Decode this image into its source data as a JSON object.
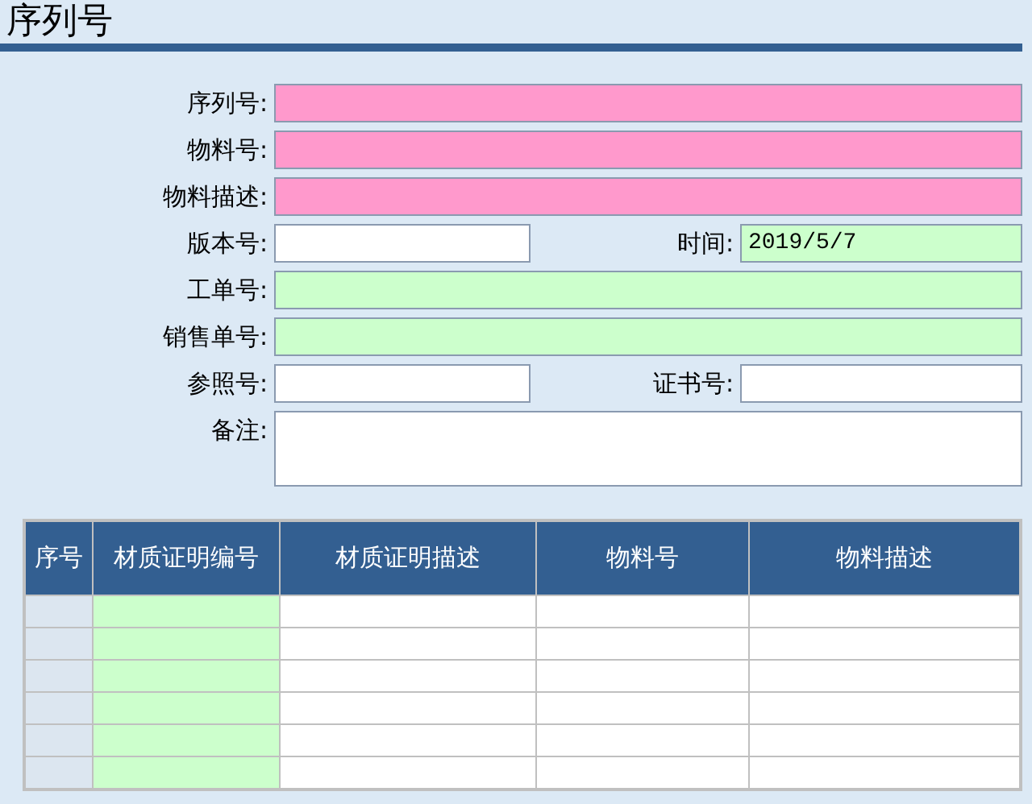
{
  "title": "序列号",
  "form": {
    "rows": [
      {
        "fields": [
          {
            "label": "序列号:",
            "color": "#ff99cc",
            "kind": "input"
          }
        ]
      },
      {
        "fields": [
          {
            "label": "物料号:",
            "color": "#ff99cc",
            "kind": "input"
          }
        ]
      },
      {
        "fields": [
          {
            "label": "物料描述:",
            "color": "#ff99cc",
            "kind": "input"
          }
        ]
      },
      {
        "fields": [
          {
            "label": "版本号:",
            "color": "#ffffff",
            "kind": "input"
          },
          {
            "label": "时间:",
            "color": "#ccffcc",
            "kind": "input",
            "value": "2019/5/7"
          }
        ]
      },
      {
        "fields": [
          {
            "label": "工单号:",
            "color": "#ccffcc",
            "kind": "input"
          }
        ]
      },
      {
        "fields": [
          {
            "label": "销售单号:",
            "color": "#ccffcc",
            "kind": "input"
          }
        ]
      },
      {
        "fields": [
          {
            "label": "参照号:",
            "color": "#ffffff",
            "kind": "input"
          },
          {
            "label": "证书号:",
            "color": "#ffffff",
            "kind": "input"
          }
        ]
      },
      {
        "fields": [
          {
            "label": "备注:",
            "color": "#ffffff",
            "kind": "textarea"
          }
        ]
      }
    ]
  },
  "table": {
    "columns": [
      {
        "label": "序号",
        "color": "#dce6f0"
      },
      {
        "label": "材质证明编号",
        "color": "#ccffcc"
      },
      {
        "label": "材质证明描述",
        "color": "#ffffff"
      },
      {
        "label": "物料号",
        "color": "#ffffff"
      },
      {
        "label": "物料描述",
        "color": "#ffffff"
      }
    ],
    "rows": [
      {
        "kind": "empty"
      },
      {
        "kind": "empty"
      },
      {
        "kind": "empty"
      },
      {
        "kind": "empty"
      },
      {
        "kind": "empty"
      },
      {
        "kind": "empty"
      }
    ]
  }
}
